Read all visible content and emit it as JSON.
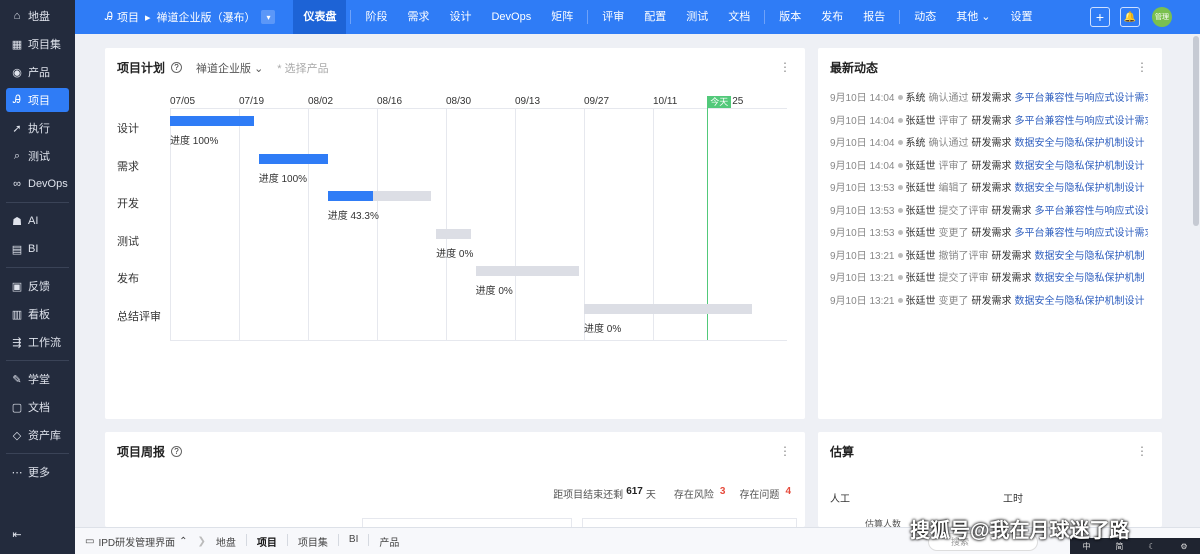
{
  "sidebar": {
    "items": [
      {
        "label": "地盘",
        "icon": "home-icon"
      },
      {
        "label": "项目集",
        "icon": "grid-icon"
      },
      {
        "label": "产品",
        "icon": "location-pin-icon"
      },
      {
        "label": "项目",
        "icon": "project-a-icon"
      },
      {
        "label": "执行",
        "icon": "rocket-icon"
      },
      {
        "label": "测试",
        "icon": "search-icon"
      },
      {
        "label": "DevOps",
        "icon": "infinity-icon"
      },
      {
        "label": "AI",
        "icon": "robot-icon"
      },
      {
        "label": "BI",
        "icon": "chart-icon"
      },
      {
        "label": "反馈",
        "icon": "feedback-icon"
      },
      {
        "label": "看板",
        "icon": "board-icon"
      },
      {
        "label": "工作流",
        "icon": "workflow-icon"
      },
      {
        "label": "学堂",
        "icon": "school-icon"
      },
      {
        "label": "文档",
        "icon": "document-icon"
      },
      {
        "label": "资产库",
        "icon": "diamond-icon"
      },
      {
        "label": "更多",
        "icon": "more-icon"
      }
    ]
  },
  "topbar": {
    "crumb_root": "项目",
    "crumb_project": "禅道企业版（瀑布）",
    "nav": [
      "仪表盘",
      "阶段",
      "需求",
      "设计",
      "DevOps",
      "矩阵",
      "评审",
      "配置",
      "测试",
      "文档",
      "版本",
      "发布",
      "报告",
      "动态",
      "其他",
      "设置"
    ],
    "avatar": "管理"
  },
  "plan": {
    "title": "项目计划",
    "product_select": "禅道企业版",
    "product_placeholder": "* 选择产品",
    "today_label": "今天",
    "after_today": "25"
  },
  "chart_data": {
    "type": "gantt",
    "x_ticks": [
      "07/05",
      "07/19",
      "08/02",
      "08/16",
      "08/30",
      "09/13",
      "09/27",
      "10/11"
    ],
    "rows": [
      {
        "name": "设计",
        "start": "07/05",
        "end": "07/22",
        "progress": 100,
        "label": "进度 100%"
      },
      {
        "name": "需求",
        "start": "07/23",
        "end": "08/06",
        "progress": 100,
        "label": "进度 100%"
      },
      {
        "name": "开发",
        "start": "08/06",
        "end": "08/27",
        "progress": 43.3,
        "label": "进度 43.3%"
      },
      {
        "name": "测试",
        "start": "08/28",
        "end": "09/04",
        "progress": 0,
        "label": "进度 0%"
      },
      {
        "name": "发布",
        "start": "09/05",
        "end": "09/26",
        "progress": 0,
        "label": "进度 0%"
      },
      {
        "name": "总结评审",
        "start": "09/27",
        "end": "10/31",
        "progress": 0,
        "label": "进度 0%"
      }
    ],
    "today": "10/22",
    "colors": {
      "done": "#2f7cf6",
      "todo": "#dcdee5",
      "today": "#52c97a"
    }
  },
  "feed": {
    "title": "最新动态",
    "items": [
      {
        "time": "9月10日 14:04",
        "user": "系统",
        "action": "确认通过",
        "kind": "研发需求",
        "link": "多平台兼容性与响应式设计需求"
      },
      {
        "time": "9月10日 14:04",
        "user": "张廷世",
        "action": "评审了",
        "kind": "研发需求",
        "link": "多平台兼容性与响应式设计需求"
      },
      {
        "time": "9月10日 14:04",
        "user": "系统",
        "action": "确认通过",
        "kind": "研发需求",
        "link": "数据安全与隐私保护机制设计"
      },
      {
        "time": "9月10日 14:04",
        "user": "张廷世",
        "action": "评审了",
        "kind": "研发需求",
        "link": "数据安全与隐私保护机制设计"
      },
      {
        "time": "9月10日 13:53",
        "user": "张廷世",
        "action": "编辑了",
        "kind": "研发需求",
        "link": "数据安全与隐私保护机制设计"
      },
      {
        "time": "9月10日 13:53",
        "user": "张廷世",
        "action": "提交了评审",
        "kind": "研发需求",
        "link": "多平台兼容性与响应式设计"
      },
      {
        "time": "9月10日 13:53",
        "user": "张廷世",
        "action": "变更了",
        "kind": "研发需求",
        "link": "多平台兼容性与响应式设计需求"
      },
      {
        "time": "9月10日 13:21",
        "user": "张廷世",
        "action": "撤销了评审",
        "kind": "研发需求",
        "link": "数据安全与隐私保护机制"
      },
      {
        "time": "9月10日 13:21",
        "user": "张廷世",
        "action": "提交了评审",
        "kind": "研发需求",
        "link": "数据安全与隐私保护机制"
      },
      {
        "time": "9月10日 13:21",
        "user": "张廷世",
        "action": "变更了",
        "kind": "研发需求",
        "link": "数据安全与隐私保护机制设计"
      }
    ]
  },
  "weekly": {
    "title": "项目周报",
    "remain_prefix": "距项目结束还剩",
    "remain_days": "617",
    "remain_unit": "天",
    "risk_label": "存在风险",
    "risk_count": "3",
    "issue_label": "存在问题",
    "issue_count": "4"
  },
  "estimate": {
    "title": "估算",
    "labor": "人工",
    "hours": "工时",
    "estimators": "估算人数"
  },
  "bottombar": {
    "app_label": "IPD研发管理界面",
    "tabs": [
      "地盘",
      "项目",
      "项目集",
      "BI",
      "产品"
    ],
    "search_placeholder": "搜索"
  },
  "watermark": "搜狐号@我在月球迷了路",
  "tray": [
    "中",
    "简"
  ]
}
